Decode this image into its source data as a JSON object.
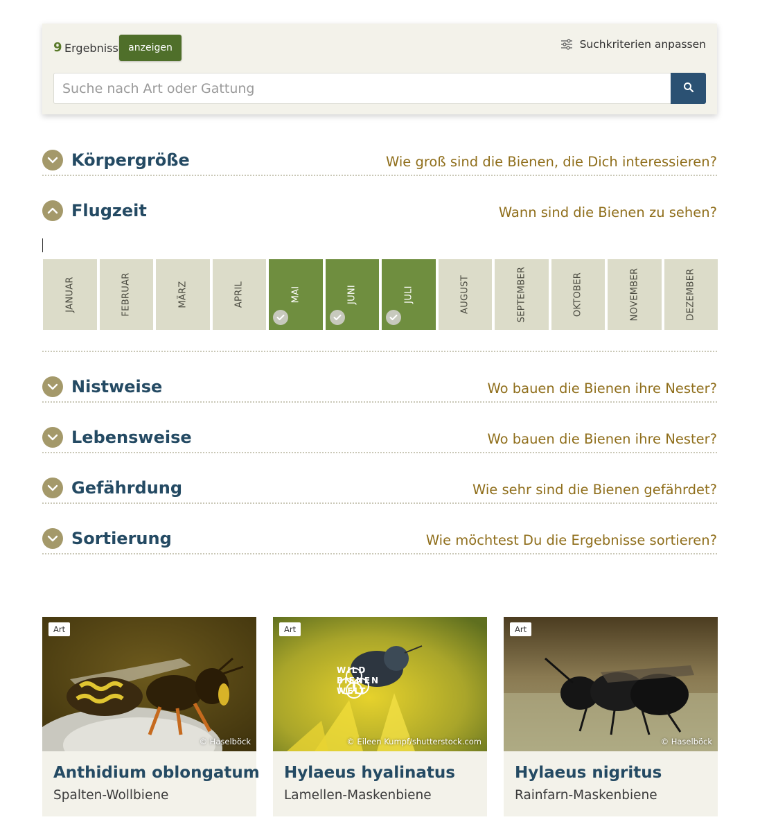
{
  "search": {
    "count": "9",
    "results_label": "Ergebnisse",
    "show_button": "anzeigen",
    "adjust_label": "Suchkriterien anpassen",
    "placeholder": "Suche nach Art oder Gattung"
  },
  "filters": [
    {
      "title": "Körpergröße",
      "question": "Wie groß sind die Bienen, die Dich interessieren?",
      "expanded": false
    },
    {
      "title": "Flugzeit",
      "question": "Wann sind die Bienen zu sehen?",
      "expanded": true
    },
    {
      "title": "Nistweise",
      "question": "Wo bauen die Bienen ihre Nester?",
      "expanded": false
    },
    {
      "title": "Lebensweise",
      "question": "Wo bauen die Bienen ihre Nester?",
      "expanded": false
    },
    {
      "title": "Gefährdung",
      "question": "Wie sehr sind die Bienen gefährdet?",
      "expanded": false
    },
    {
      "title": "Sortierung",
      "question": "Wie möchtest Du die Ergebnisse sortieren?",
      "expanded": false
    }
  ],
  "months": [
    {
      "label": "JANUAR",
      "selected": false
    },
    {
      "label": "FEBRUAR",
      "selected": false
    },
    {
      "label": "MÄRZ",
      "selected": false
    },
    {
      "label": "APRIL",
      "selected": false
    },
    {
      "label": "MAI",
      "selected": true
    },
    {
      "label": "JUNI",
      "selected": true
    },
    {
      "label": "JULI",
      "selected": true
    },
    {
      "label": "AUGUST",
      "selected": false
    },
    {
      "label": "SEPTEMBER",
      "selected": false
    },
    {
      "label": "OKTOBER",
      "selected": false
    },
    {
      "label": "NOVEMBER",
      "selected": false
    },
    {
      "label": "DEZEMBER",
      "selected": false
    }
  ],
  "cards": [
    {
      "badge": "Art",
      "credit": "© Haselböck",
      "title": "Anthidium oblongatum",
      "subtitle": "Spalten-Wollbiene"
    },
    {
      "badge": "Art",
      "credit": "© Eileen Kumpf/shutterstock.com",
      "title": "Hylaeus hyalinatus",
      "subtitle": "Lamellen-Maskenbiene",
      "watermark": [
        "WILD",
        "BIENEN",
        "WELT"
      ]
    },
    {
      "badge": "Art",
      "credit": "© Haselböck",
      "title": "Hylaeus nigritus",
      "subtitle": "Rainfarn-Maskenbiene"
    }
  ],
  "colors": {
    "accent_green": "#4f6f2a",
    "selected_month": "#6f8e3f",
    "heading_blue": "#244a63",
    "question_gold": "#8f6e1b",
    "toggle_bg": "#a4996a",
    "search_button": "#2b5173"
  },
  "icons": {
    "adjust": "sliders-icon",
    "search": "magnifier-icon",
    "collapsed": "chevron-down-icon",
    "expanded": "chevron-up-icon",
    "selected_month": "check-icon"
  }
}
